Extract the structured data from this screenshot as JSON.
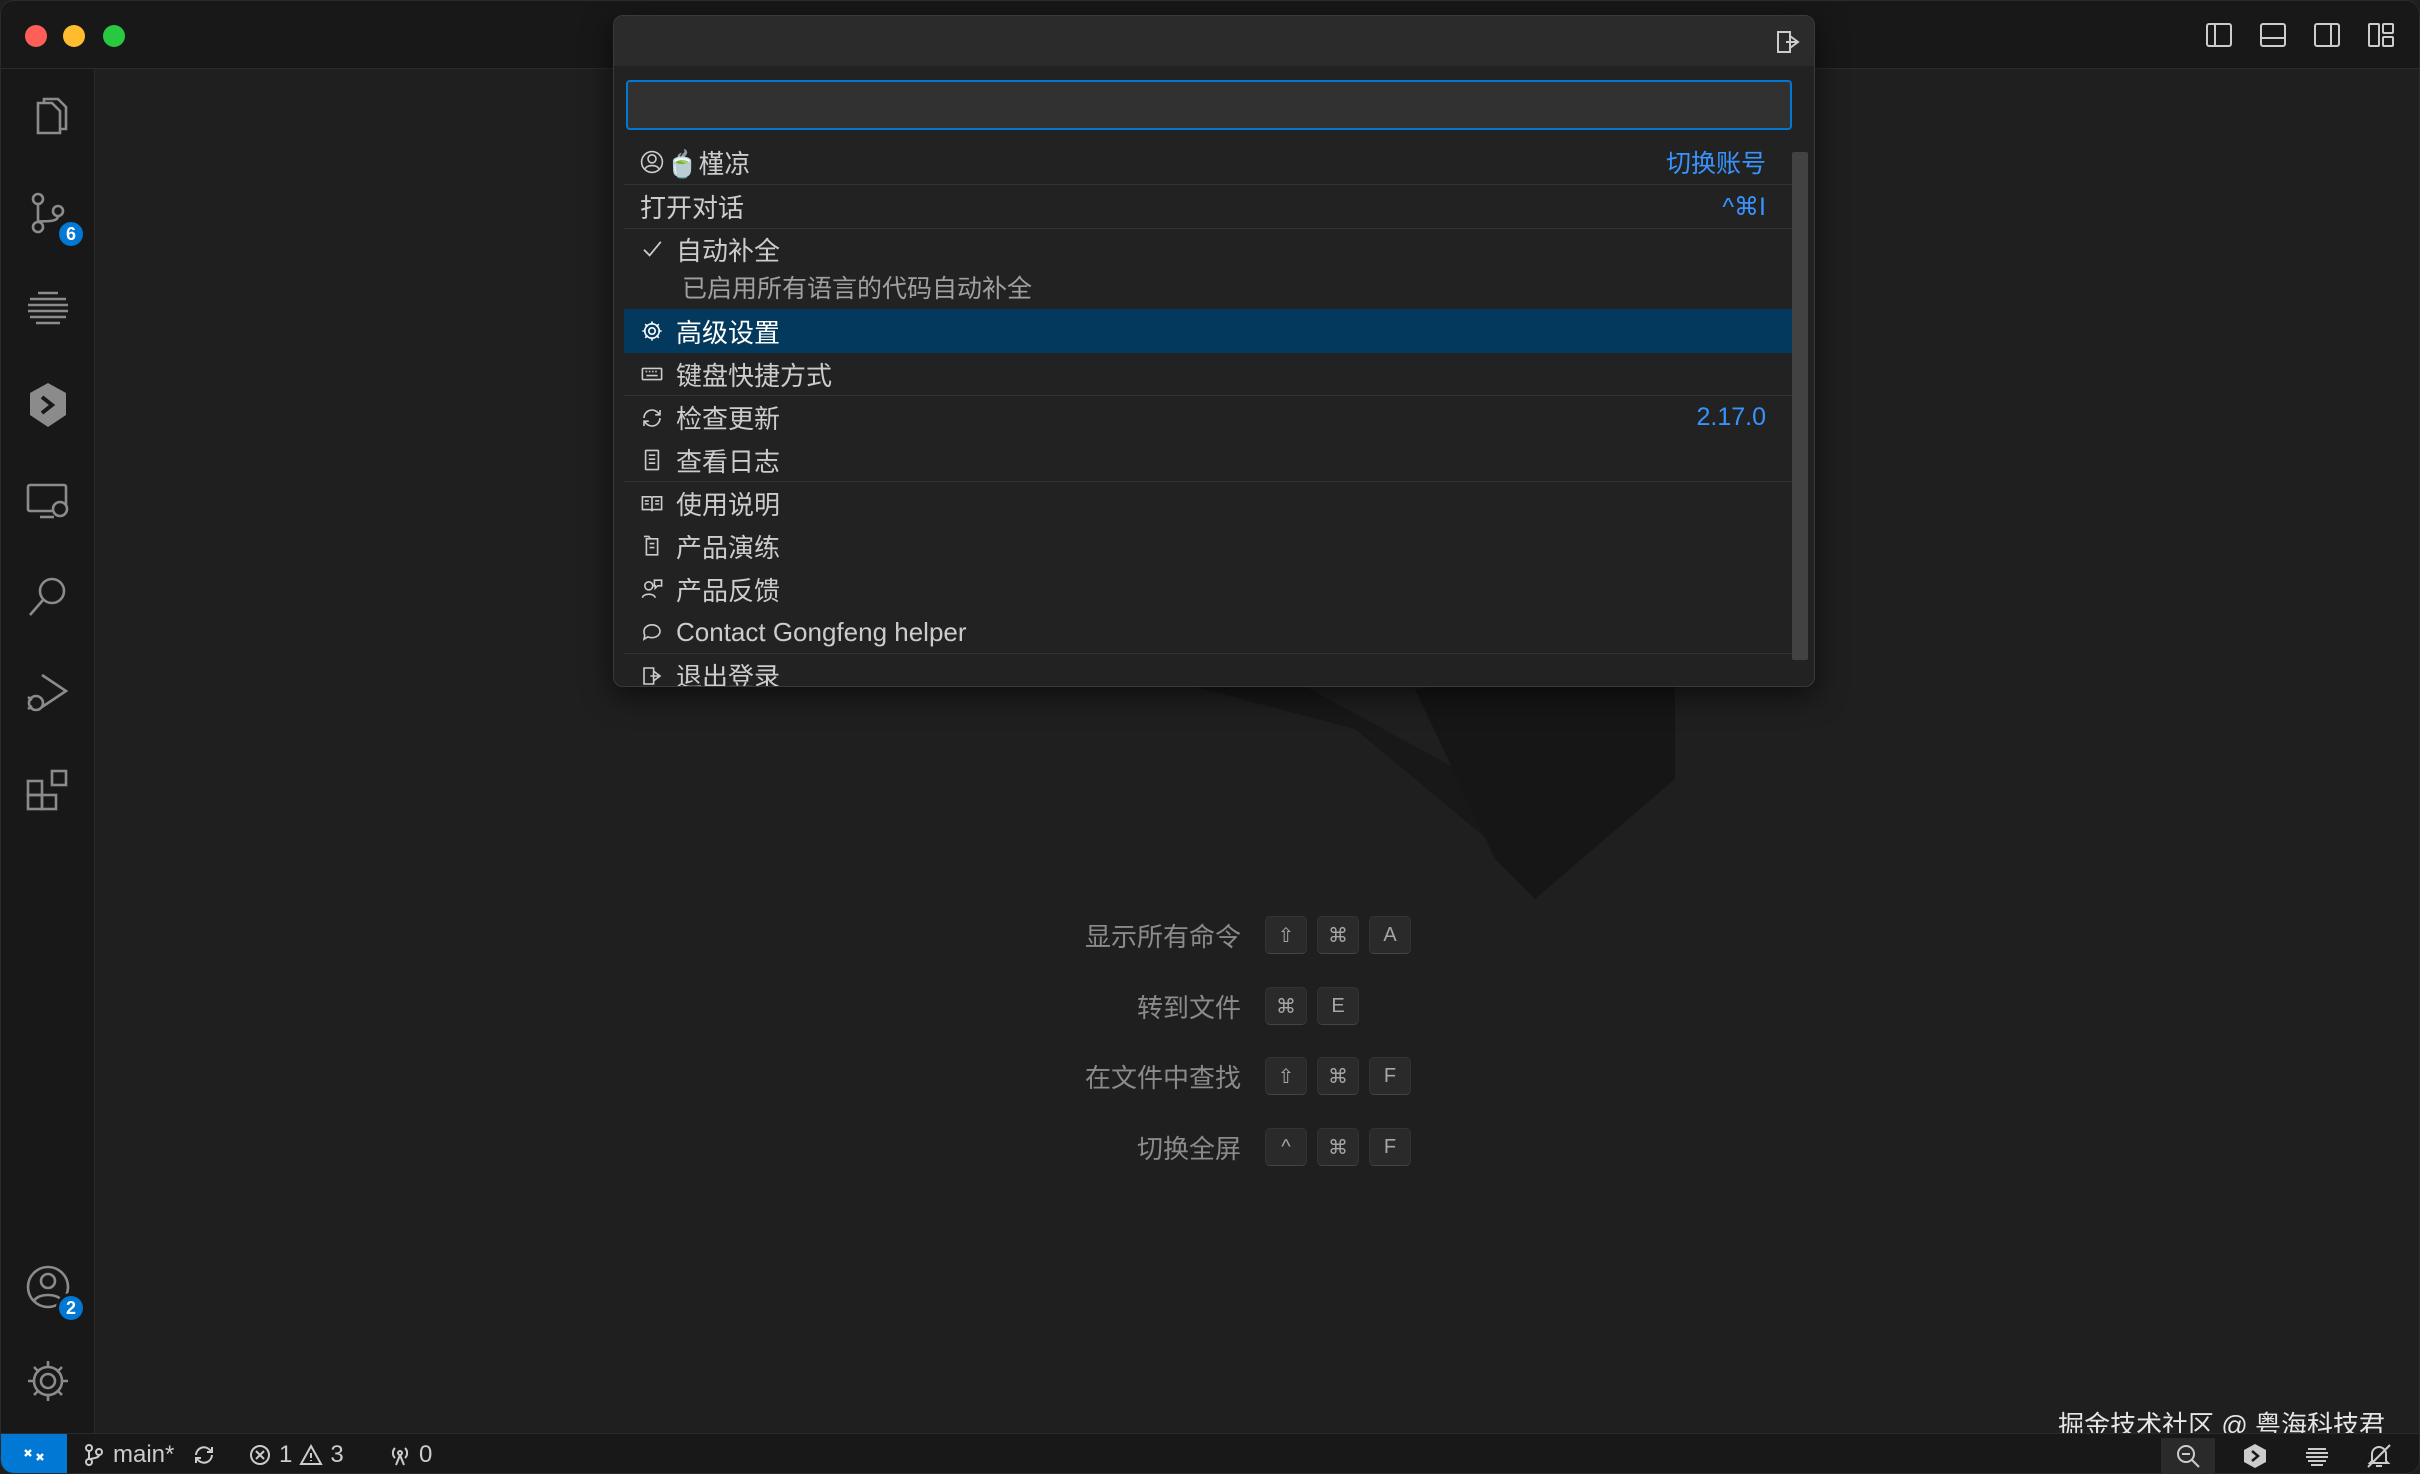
{
  "quickpick": {
    "input_value": "",
    "account": {
      "name": "🍵槿凉",
      "action": "切换账号"
    },
    "items": [
      {
        "label": "打开对话",
        "shortcut": "^⌘I"
      },
      {
        "label": "自动补全",
        "description": "已启用所有语言的代码自动补全",
        "checked": true
      },
      {
        "label": "高级设置",
        "selected": true
      },
      {
        "label": "键盘快捷方式"
      },
      {
        "label": "检查更新",
        "version": "2.17.0"
      },
      {
        "label": "查看日志"
      },
      {
        "label": "使用说明"
      },
      {
        "label": "产品演练"
      },
      {
        "label": "产品反馈"
      },
      {
        "label": "Contact Gongfeng helper"
      },
      {
        "label": "退出登录"
      }
    ]
  },
  "activity": {
    "source_control_badge": "6",
    "accounts_badge": "2"
  },
  "shortcuts": [
    {
      "label": "显示所有命令",
      "keys": [
        "⇧",
        "⌘",
        "A"
      ]
    },
    {
      "label": "转到文件",
      "keys": [
        "⌘",
        "E"
      ]
    },
    {
      "label": "在文件中查找",
      "keys": [
        "⇧",
        "⌘",
        "F"
      ]
    },
    {
      "label": "切换全屏",
      "keys": [
        "^",
        "⌘",
        "F"
      ]
    }
  ],
  "statusbar": {
    "branch": "main*",
    "errors": "1",
    "warnings": "3",
    "ports": "0"
  },
  "watermark": "掘金技术社区 @ 粤海科技君",
  "colors": {
    "accent": "#0078d4",
    "link": "#3794ff",
    "selection": "#04395e"
  }
}
